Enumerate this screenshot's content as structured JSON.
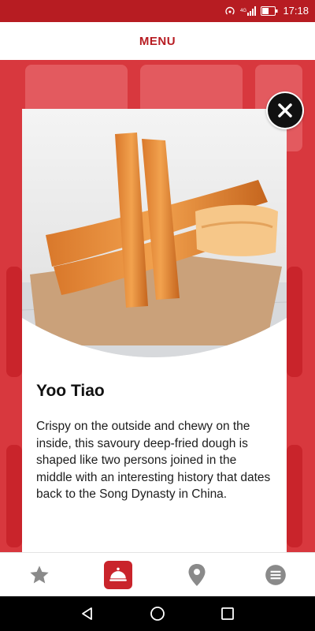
{
  "status_bar": {
    "time": "17:18",
    "network": "4G"
  },
  "header": {
    "title": "MENU"
  },
  "modal": {
    "title": "Yoo Tiao",
    "description": "Crispy on the outside and chewy on the inside, this savoury deep-fried dough is shaped like two persons joined in the middle with an interesting history that dates back to the Song Dynasty in China."
  },
  "bottom_nav": {
    "items": [
      {
        "name": "favourites",
        "icon": "star-icon",
        "active": false
      },
      {
        "name": "menu",
        "icon": "cloche-icon",
        "active": true
      },
      {
        "name": "locations",
        "icon": "location-pin-icon",
        "active": false
      },
      {
        "name": "more",
        "icon": "hamburger-menu-icon",
        "active": false
      }
    ]
  },
  "colors": {
    "brand": "#c9242b",
    "header_title": "#b71c22"
  }
}
